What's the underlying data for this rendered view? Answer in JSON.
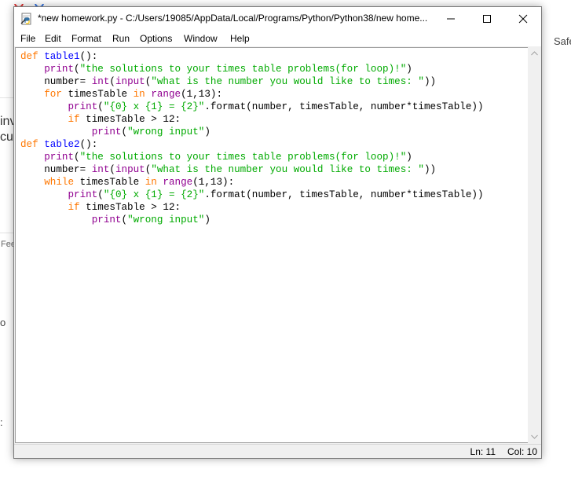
{
  "window": {
    "title": "*new homework.py - C:/Users/19085/AppData/Local/Programs/Python/Python38/new home..."
  },
  "menu": [
    "File",
    "Edit",
    "Format",
    "Run",
    "Options",
    "Window",
    "Help"
  ],
  "code_lines": [
    [
      [
        "kw",
        "def"
      ],
      [
        "t",
        " "
      ],
      [
        "df",
        "table1"
      ],
      [
        "t",
        "():"
      ]
    ],
    [
      [
        "t",
        "    "
      ],
      [
        "bi",
        "print"
      ],
      [
        "t",
        "("
      ],
      [
        "st",
        "\"the solutions to your times table problems(for loop)!\""
      ],
      [
        "t",
        ")"
      ]
    ],
    [
      [
        "t",
        "    number= "
      ],
      [
        "bi",
        "int"
      ],
      [
        "t",
        "("
      ],
      [
        "bi",
        "input"
      ],
      [
        "t",
        "("
      ],
      [
        "st",
        "\"what is the number you would like to times: \""
      ],
      [
        "t",
        "))"
      ]
    ],
    [
      [
        "t",
        "    "
      ],
      [
        "kw",
        "for"
      ],
      [
        "t",
        " timesTable "
      ],
      [
        "kw",
        "in"
      ],
      [
        "t",
        " "
      ],
      [
        "bi",
        "range"
      ],
      [
        "t",
        "(1,13):"
      ]
    ],
    [
      [
        "t",
        "        "
      ],
      [
        "bi",
        "print"
      ],
      [
        "t",
        "("
      ],
      [
        "st",
        "\"{0} x {1} = {2}\""
      ],
      [
        "t",
        ".format(number, timesTable, number*timesTable))"
      ]
    ],
    [
      [
        "t",
        "        "
      ],
      [
        "kw",
        "if"
      ],
      [
        "t",
        " timesTable > 12:"
      ]
    ],
    [
      [
        "t",
        "            "
      ],
      [
        "bi",
        "print"
      ],
      [
        "t",
        "("
      ],
      [
        "st",
        "\"wrong input\""
      ],
      [
        "t",
        ")"
      ]
    ],
    [
      [
        "kw",
        "def"
      ],
      [
        "t",
        " "
      ],
      [
        "df",
        "table2"
      ],
      [
        "t",
        "():"
      ]
    ],
    [
      [
        "t",
        "    "
      ],
      [
        "bi",
        "print"
      ],
      [
        "t",
        "("
      ],
      [
        "st",
        "\"the solutions to your times table problems(for loop)!\""
      ],
      [
        "t",
        ")"
      ]
    ],
    [
      [
        "t",
        "    number= "
      ],
      [
        "bi",
        "int"
      ],
      [
        "t",
        "("
      ],
      [
        "bi",
        "input"
      ],
      [
        "t",
        "("
      ],
      [
        "st",
        "\"what is the number you would like to times: \""
      ],
      [
        "t",
        "))"
      ]
    ],
    [
      [
        "t",
        "    "
      ],
      [
        "kw",
        "while"
      ],
      [
        "t",
        " timesTable "
      ],
      [
        "kw",
        "in"
      ],
      [
        "t",
        " "
      ],
      [
        "bi",
        "range"
      ],
      [
        "t",
        "(1,13):"
      ]
    ],
    [
      [
        "t",
        "        "
      ],
      [
        "bi",
        "print"
      ],
      [
        "t",
        "("
      ],
      [
        "st",
        "\"{0} x {1} = {2}\""
      ],
      [
        "t",
        ".format(number, timesTable, number*timesTable))"
      ]
    ],
    [
      [
        "t",
        "        "
      ],
      [
        "kw",
        "if"
      ],
      [
        "t",
        " timesTable > 12:"
      ]
    ],
    [
      [
        "t",
        "            "
      ],
      [
        "bi",
        "print"
      ],
      [
        "t",
        "("
      ],
      [
        "st",
        "\"wrong input\""
      ],
      [
        "t",
        ")"
      ]
    ]
  ],
  "status": {
    "ln": "Ln: 11",
    "col": "Col: 10"
  },
  "background": {
    "right_fragment": "Safe",
    "left_fragment_1": "inv",
    "left_fragment_2": "cus",
    "left_fragment_3": "Fee",
    "left_fragment_4": "o",
    "left_fragment_5": ":"
  },
  "colors": {
    "keyword": "#ff7700",
    "builtin": "#900090",
    "string": "#00aa00",
    "definition": "#0000ff"
  }
}
